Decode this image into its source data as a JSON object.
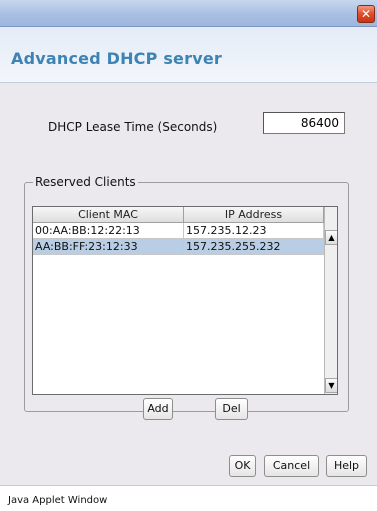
{
  "window": {
    "close_glyph": "✕"
  },
  "dialog": {
    "title": "Advanced DHCP server",
    "lease": {
      "label": "DHCP Lease Time (Seconds)",
      "value": "86400"
    },
    "reserved_clients": {
      "group_label": "Reserved Clients",
      "columns": [
        "Client MAC",
        "IP Address"
      ],
      "rows": [
        {
          "mac": "00:AA:BB:12:22:13",
          "ip": "157.235.12.23",
          "selected": false
        },
        {
          "mac": "AA:BB:FF:23:12:33",
          "ip": "157.235.255.232",
          "selected": true
        }
      ],
      "scroll_up_glyph": "▲",
      "scroll_down_glyph": "▼"
    },
    "buttons": {
      "add": "Add",
      "del": "Del",
      "ok": "OK",
      "cancel": "Cancel",
      "help": "Help"
    }
  },
  "status_bar": {
    "text": "Java Applet Window"
  },
  "colors": {
    "title_blue": "#3d84b5",
    "selection": "#b9cde4",
    "close_red": "#df4d2c"
  }
}
